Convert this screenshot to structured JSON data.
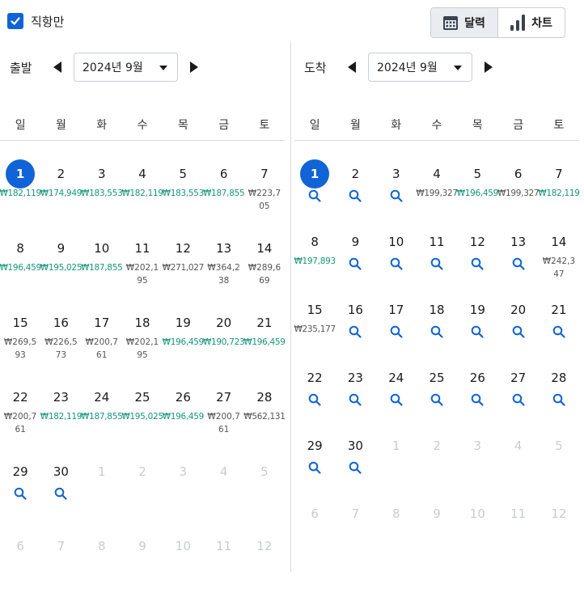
{
  "direct_only": {
    "label": "직항만",
    "checked": true
  },
  "view_toggle": {
    "calendar_label": "달력",
    "chart_label": "차트",
    "active": "calendar"
  },
  "colors": {
    "accent": "#1164d6",
    "low_price": "#15967a",
    "normal_price": "#555555",
    "muted": "#c8ccd2"
  },
  "weekdays": [
    "일",
    "월",
    "화",
    "수",
    "목",
    "금",
    "토"
  ],
  "departure": {
    "title": "출발",
    "month": "2024년 9월",
    "selected_day": 1,
    "days": [
      {
        "d": "1",
        "p": "₩182,119",
        "low": true,
        "sel": true
      },
      {
        "d": "2",
        "p": "₩174,949",
        "low": true
      },
      {
        "d": "3",
        "p": "₩183,553",
        "low": true
      },
      {
        "d": "4",
        "p": "₩182,119",
        "low": true
      },
      {
        "d": "5",
        "p": "₩183,553",
        "low": true
      },
      {
        "d": "6",
        "p": "₩187,855",
        "low": true
      },
      {
        "d": "7",
        "p": "₩223,705",
        "low": false
      },
      {
        "d": "8",
        "p": "₩196,459",
        "low": true
      },
      {
        "d": "9",
        "p": "₩195,025",
        "low": true
      },
      {
        "d": "10",
        "p": "₩187,855",
        "low": true
      },
      {
        "d": "11",
        "p": "₩202,195",
        "low": false
      },
      {
        "d": "12",
        "p": "₩271,027",
        "low": false
      },
      {
        "d": "13",
        "p": "₩364,238",
        "low": false
      },
      {
        "d": "14",
        "p": "₩289,669",
        "low": false
      },
      {
        "d": "15",
        "p": "₩269,593",
        "low": false
      },
      {
        "d": "16",
        "p": "₩226,573",
        "low": false
      },
      {
        "d": "17",
        "p": "₩200,761",
        "low": false
      },
      {
        "d": "18",
        "p": "₩202,195",
        "low": false
      },
      {
        "d": "19",
        "p": "₩196,459",
        "low": true
      },
      {
        "d": "20",
        "p": "₩190,723",
        "low": true
      },
      {
        "d": "21",
        "p": "₩196,459",
        "low": true
      },
      {
        "d": "22",
        "p": "₩200,761",
        "low": false
      },
      {
        "d": "23",
        "p": "₩182,119",
        "low": true
      },
      {
        "d": "24",
        "p": "₩187,855",
        "low": true
      },
      {
        "d": "25",
        "p": "₩195,025",
        "low": true
      },
      {
        "d": "26",
        "p": "₩196,459",
        "low": true
      },
      {
        "d": "27",
        "p": "₩200,761",
        "low": false
      },
      {
        "d": "28",
        "p": "₩562,131",
        "low": false
      },
      {
        "d": "29",
        "search": true
      },
      {
        "d": "30",
        "search": true
      },
      {
        "d": "1",
        "out": true
      },
      {
        "d": "2",
        "out": true
      },
      {
        "d": "3",
        "out": true
      },
      {
        "d": "4",
        "out": true
      },
      {
        "d": "5",
        "out": true
      },
      {
        "d": "6",
        "out": true
      },
      {
        "d": "7",
        "out": true
      },
      {
        "d": "8",
        "out": true
      },
      {
        "d": "9",
        "out": true
      },
      {
        "d": "10",
        "out": true
      },
      {
        "d": "11",
        "out": true
      },
      {
        "d": "12",
        "out": true
      }
    ]
  },
  "arrival": {
    "title": "도착",
    "month": "2024년 9월",
    "selected_day": 1,
    "days": [
      {
        "d": "1",
        "search": true,
        "sel": true
      },
      {
        "d": "2",
        "search": true
      },
      {
        "d": "3",
        "search": true
      },
      {
        "d": "4",
        "p": "₩199,327",
        "low": false
      },
      {
        "d": "5",
        "p": "₩196,459",
        "low": true
      },
      {
        "d": "6",
        "p": "₩199,327",
        "low": false
      },
      {
        "d": "7",
        "p": "₩182,119",
        "low": true
      },
      {
        "d": "8",
        "p": "₩197,893",
        "low": true
      },
      {
        "d": "9",
        "search": true
      },
      {
        "d": "10",
        "search": true
      },
      {
        "d": "11",
        "search": true
      },
      {
        "d": "12",
        "search": true
      },
      {
        "d": "13",
        "search": true
      },
      {
        "d": "14",
        "p": "₩242,347",
        "low": false
      },
      {
        "d": "15",
        "p": "₩235,177",
        "low": false
      },
      {
        "d": "16",
        "search": true
      },
      {
        "d": "17",
        "search": true
      },
      {
        "d": "18",
        "search": true
      },
      {
        "d": "19",
        "search": true
      },
      {
        "d": "20",
        "search": true
      },
      {
        "d": "21",
        "search": true
      },
      {
        "d": "22",
        "search": true
      },
      {
        "d": "23",
        "search": true
      },
      {
        "d": "24",
        "search": true
      },
      {
        "d": "25",
        "search": true
      },
      {
        "d": "26",
        "search": true
      },
      {
        "d": "27",
        "search": true
      },
      {
        "d": "28",
        "search": true
      },
      {
        "d": "29",
        "search": true
      },
      {
        "d": "30",
        "search": true
      },
      {
        "d": "1",
        "out": true
      },
      {
        "d": "2",
        "out": true
      },
      {
        "d": "3",
        "out": true
      },
      {
        "d": "4",
        "out": true
      },
      {
        "d": "5",
        "out": true
      },
      {
        "d": "6",
        "out": true
      },
      {
        "d": "7",
        "out": true
      },
      {
        "d": "8",
        "out": true
      },
      {
        "d": "9",
        "out": true
      },
      {
        "d": "10",
        "out": true
      },
      {
        "d": "11",
        "out": true
      },
      {
        "d": "12",
        "out": true
      }
    ]
  }
}
